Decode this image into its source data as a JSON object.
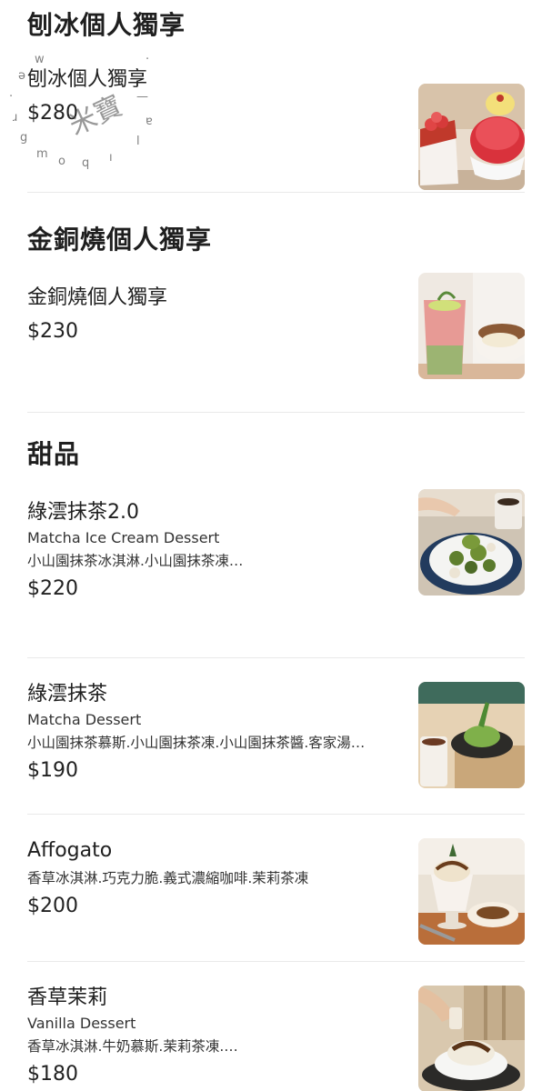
{
  "sections": [
    {
      "title": "刨冰個人獨享",
      "items": [
        {
          "name": "刨冰個人獨享",
          "en": "",
          "desc": "",
          "price": "$280"
        }
      ]
    },
    {
      "title": "金銅燒個人獨享",
      "items": [
        {
          "name": "金銅燒個人獨享",
          "en": "",
          "desc": "",
          "price": "$230"
        }
      ]
    },
    {
      "title": "甜品",
      "items": [
        {
          "name": "綠澐抹茶2.0",
          "en": "Matcha Ice Cream Dessert",
          "desc": "小山園抹茶冰淇淋.小山園抹茶凍…",
          "price": "$220"
        },
        {
          "name": "綠澐抹茶",
          "en": "Matcha Dessert",
          "desc": "小山園抹茶慕斯.小山園抹茶凍.小山園抹茶醬.客家湯…",
          "price": "$190"
        },
        {
          "name": "Affogato",
          "en": "",
          "desc": "香草冰淇淋.巧克力脆.義式濃縮咖啡.茉莉茶凍",
          "price": "$200"
        },
        {
          "name": "香草茉莉",
          "en": "Vanilla Dessert",
          "desc": "香草冰淇淋.牛奶慕斯.茉莉茶凍.…",
          "price": "$180"
        }
      ]
    }
  ],
  "watermark": {
    "cjk": "米寶",
    "ring": "w a l b m o a q i l l"
  },
  "icons": [
    "shaved-ice-photo",
    "dorayaki-drink-photo",
    "matcha-ice-cream-photo",
    "matcha-dessert-photo",
    "affogato-photo",
    "vanilla-dessert-photo"
  ]
}
